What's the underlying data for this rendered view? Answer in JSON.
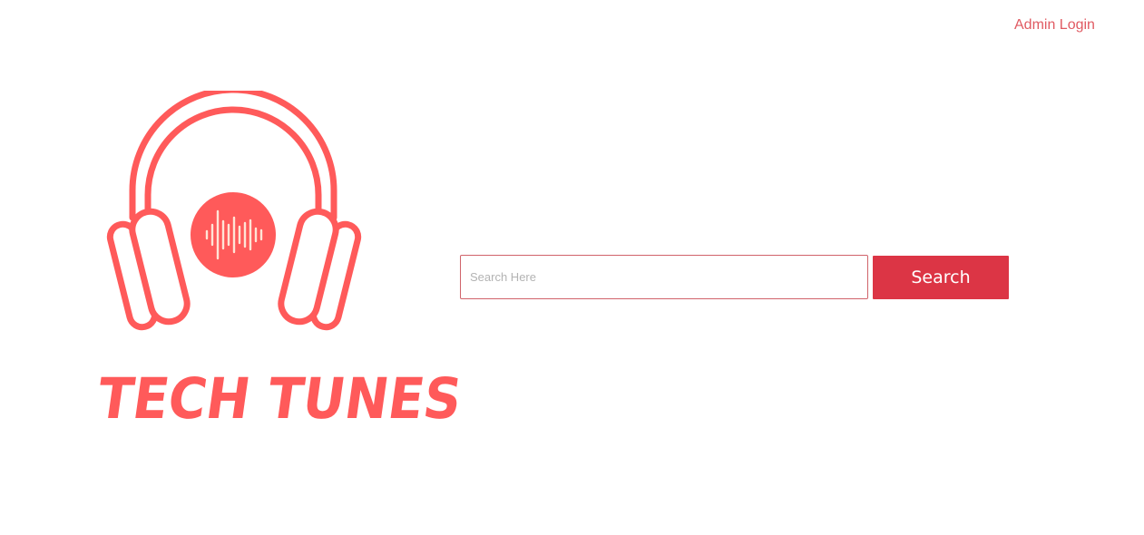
{
  "header": {
    "admin_login_label": "Admin Login"
  },
  "logo": {
    "text": "TECH TUNES",
    "icon": "headphones-icon",
    "color": "#ff5a5a"
  },
  "search": {
    "placeholder": "Search Here",
    "value": "",
    "button_label": "Search",
    "button_color": "#dc3545",
    "border_color": "#d0636a"
  },
  "colors": {
    "link": "#e05a62",
    "brand": "#ff5a5a",
    "button": "#dc3545",
    "background": "#ffffff"
  }
}
